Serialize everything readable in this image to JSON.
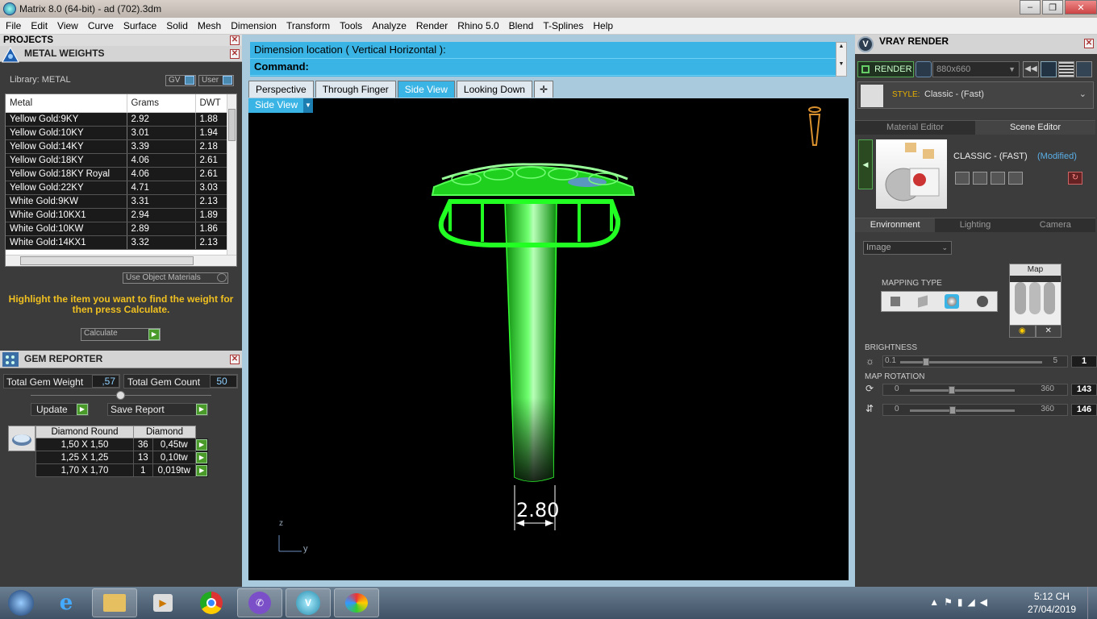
{
  "window": {
    "title": "Matrix 8.0 (64-bit) - ad (702).3dm"
  },
  "menu": [
    "File",
    "Edit",
    "View",
    "Curve",
    "Surface",
    "Solid",
    "Mesh",
    "Dimension",
    "Transform",
    "Tools",
    "Analyze",
    "Render",
    "Rhino 5.0",
    "Blend",
    "T-Splines",
    "Help"
  ],
  "projects": {
    "title": "PROJECTS"
  },
  "metal_weights": {
    "title": "METAL WEIGHTS",
    "library": "Library: METAL",
    "gv": "GV",
    "user": "User",
    "columns": [
      "Metal",
      "Grams",
      "DWT"
    ],
    "rows": [
      [
        "Yellow Gold:9KY",
        "2.92",
        "1.88"
      ],
      [
        "Yellow Gold:10KY",
        "3.01",
        "1.94"
      ],
      [
        "Yellow Gold:14KY",
        "3.39",
        "2.18"
      ],
      [
        "Yellow Gold:18KY",
        "4.06",
        "2.61"
      ],
      [
        "Yellow Gold:18KY Royal",
        "4.06",
        "2.61"
      ],
      [
        "Yellow Gold:22KY",
        "4.71",
        "3.03"
      ],
      [
        "White Gold:9KW",
        "3.31",
        "2.13"
      ],
      [
        "White Gold:10KX1",
        "2.94",
        "1.89"
      ],
      [
        "White Gold:10KW",
        "2.89",
        "1.86"
      ],
      [
        "White Gold:14KX1",
        "3.32",
        "2.13"
      ]
    ],
    "use_object_materials": "Use Object Materials",
    "hint": "Highlight the item you want to find the weight for then press Calculate.",
    "calculate": "Calculate"
  },
  "gem_reporter": {
    "title": "GEM REPORTER",
    "total_weight_label": "Total Gem Weight",
    "total_weight": ",57",
    "total_count_label": "Total Gem Count",
    "total_count": "50",
    "update": "Update",
    "save_report": "Save Report",
    "columns": [
      "Diamond Round",
      "Diamond"
    ],
    "rows": [
      [
        "1,50 X 1,50",
        "36",
        "0,45tw"
      ],
      [
        "1,25 X 1,25",
        "13",
        "0,10tw"
      ],
      [
        "1,70 X 1,70",
        "1",
        "0,019tw"
      ]
    ]
  },
  "command": {
    "prompt": "Dimension location ( Vertical  Horizontal ):",
    "label": "Command:"
  },
  "viewport_tabs": [
    "Perspective",
    "Through Finger",
    "Side View",
    "Looking Down"
  ],
  "active_tab": "Side View",
  "viewport": {
    "label": "Side View",
    "dimension": "2.80",
    "axis_z": "z",
    "axis_y": "y"
  },
  "vray": {
    "title": "VRAY RENDER",
    "render": "RENDER",
    "resolution": "880x660",
    "style_label": "STYLE:",
    "style_value": "Classic - (Fast)",
    "tabs": [
      "Material Editor",
      "Scene Editor"
    ],
    "preset_name": "CLASSIC - (FAST)",
    "preset_state": "(Modified)",
    "env_tabs": [
      "Environment",
      "Lighting",
      "Camera"
    ],
    "image_select": "Image",
    "map_label": "Map",
    "mapping_type": "MAPPING TYPE",
    "brightness": {
      "label": "BRIGHTNESS",
      "min": "0.1",
      "max": "5",
      "value": "1",
      "level": 0.13
    },
    "rotation": {
      "label": "MAP ROTATION",
      "min": "0",
      "max": "360",
      "value1": "143",
      "value2": "146"
    }
  },
  "taskbar": {
    "time": "5:12 CH",
    "date": "27/04/2019"
  },
  "colors": {
    "accent": "#3ab4e4",
    "model_green": "#22dd22",
    "hint_yellow": "#f0c020"
  }
}
